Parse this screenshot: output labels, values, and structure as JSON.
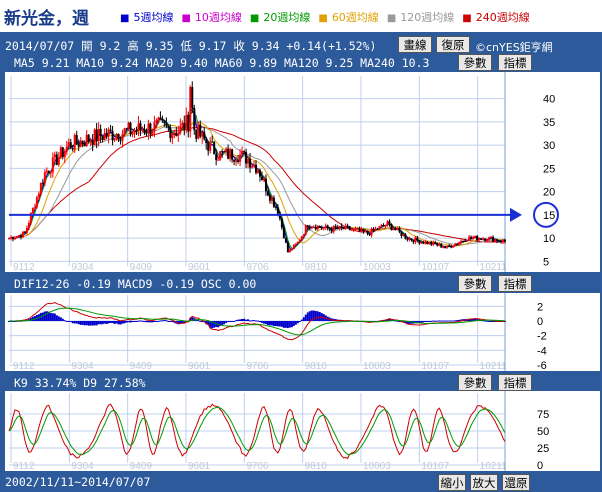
{
  "header": {
    "stock_title": "新光金，週",
    "ma_legend": [
      {
        "label": "5週均線",
        "color": "#0000cc"
      },
      {
        "label": "10週均線",
        "color": "#cc00cc"
      },
      {
        "label": "20週均線",
        "color": "#009900"
      },
      {
        "label": "60週均線",
        "color": "#e0a000"
      },
      {
        "label": "120週均線",
        "color": "#999999"
      },
      {
        "label": "240週均線",
        "color": "#cc0000"
      }
    ]
  },
  "quote_line": "2014/07/07 開 9.2 高 9.35 低 9.17 收 9.34 +0.14(+1.52%)",
  "ma_line": "MA5 9.21  MA10 9.24  MA20 9.40  MA60 9.89  MA120 9.25  MA240 10.3",
  "buttons": {
    "draw": "畫線",
    "restore": "復原",
    "params": "參數",
    "indicator": "指標",
    "zoom_out": "縮小",
    "zoom_in": "放大",
    "reset": "還原"
  },
  "copyright": "©cnYES鉅亨網",
  "macd_line": "DIF12-26 -0.19  MACD9 -0.19  OSC 0.00",
  "kd_line": "K9 33.74%  D9 27.58%",
  "date_range": "2002/11/11~2014/07/07",
  "x_ticks": [
    "9112",
    "9304",
    "9409",
    "9601",
    "9706",
    "9810",
    "10003",
    "10107",
    "10211"
  ],
  "price_axis": [
    "40",
    "35",
    "30",
    "25",
    "20",
    "15",
    "10",
    "5"
  ],
  "macd_axis": [
    "2",
    "0",
    "-2",
    "-4",
    "-6"
  ],
  "kd_axis": [
    "75",
    "50",
    "25",
    "0"
  ],
  "highlight_price": "15",
  "colors": {
    "background": "#2d5a9a",
    "candle_up": "#ff0000",
    "candle_down": "#000000",
    "highlight": "#1b2fd6"
  }
}
